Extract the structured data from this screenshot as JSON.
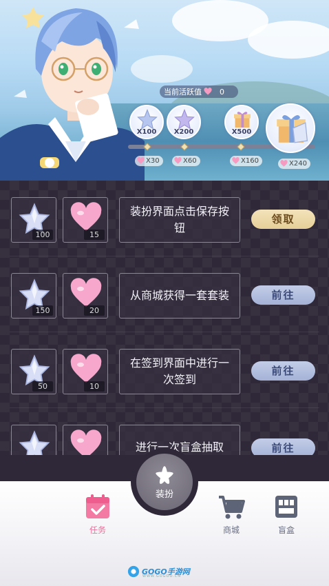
{
  "header": {
    "activity_label": "当前活跃值",
    "activity_value": "0",
    "progress_fraction": 0.0,
    "milestones": [
      {
        "reward_multiplier": "X100",
        "required": "X30"
      },
      {
        "reward_multiplier": "X200",
        "required": "X60"
      },
      {
        "reward_multiplier": "X500",
        "required": "X160"
      },
      {
        "reward_multiplier": "",
        "required": "X240"
      }
    ]
  },
  "tasks": [
    {
      "description": "装扮界面点击保存按钮",
      "star_reward": "100",
      "heart_reward": "15",
      "button": "领取",
      "button_state": "claim"
    },
    {
      "description": "从商城获得一套套装",
      "star_reward": "150",
      "heart_reward": "20",
      "button": "前往",
      "button_state": "go"
    },
    {
      "description": "在签到界面中进行一次签到",
      "star_reward": "50",
      "heart_reward": "10",
      "button": "前往",
      "button_state": "go"
    },
    {
      "description": "进行一次盲盒抽取",
      "star_reward": "",
      "heart_reward": "",
      "button": "前往",
      "button_state": "go"
    }
  ],
  "nav": {
    "tasks_label": "任务",
    "center_label": "装扮",
    "shop_label": "商城",
    "box_label": "盲盒"
  },
  "watermark": {
    "text": "GOGO手游网",
    "sub": "WWW.GOGOO.CN"
  },
  "colors": {
    "panel_bg": "#2f2838",
    "claim_button": "#e6cf98",
    "go_button": "#a5b2d6",
    "active_nav": "#f06f9a"
  }
}
